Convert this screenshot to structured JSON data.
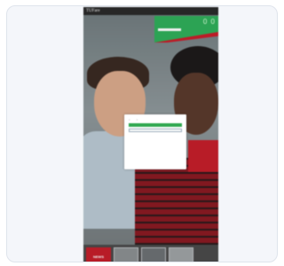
{
  "site": {
    "logo": "TUFare",
    "nav": [
      "",
      "",
      "",
      "",
      ""
    ]
  },
  "promo": {
    "headline": "",
    "counter": "0 0"
  },
  "side_panel": {
    "text": ""
  },
  "modal": {
    "title": "",
    "body": "",
    "option_a": "",
    "option_b": "",
    "link": "",
    "primary_button": "",
    "secondary_button": ""
  },
  "footer": {
    "brand": "NEWS"
  },
  "colors": {
    "accent_green": "#2fae5a",
    "accent_red": "#c81d2a",
    "card_bg": "#f4f6fa"
  }
}
